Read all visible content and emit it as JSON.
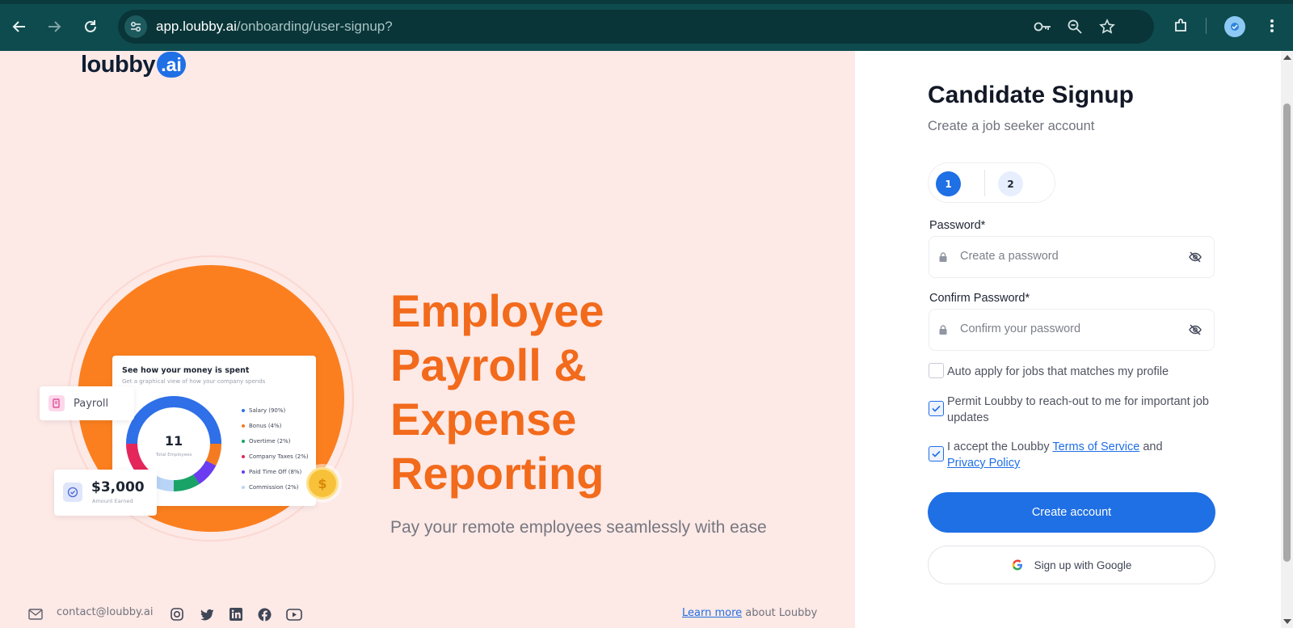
{
  "browser": {
    "url_host": "app.loubby.ai",
    "url_path": "/onboarding/user-signup?"
  },
  "brand": {
    "logo_word": "loubby",
    "logo_suffix": ".ai",
    "accent": "#1f6fe5",
    "orange": "#f26a1b"
  },
  "hero": {
    "headline": [
      "Employee",
      "Payroll &",
      "Expense",
      "Reporting"
    ],
    "tagline": "Pay your remote employees seamlessly with ease",
    "illustration": {
      "card_title": "See how your money is spent",
      "card_subtitle": "Get a graphical view of how your company spends",
      "donut_value": "11",
      "donut_label": "Total Employees",
      "legend": [
        {
          "label": "Salary (90%)",
          "color": "#2f6fe8"
        },
        {
          "label": "Bonus (4%)",
          "color": "#f47b20"
        },
        {
          "label": "Overtime (2%)",
          "color": "#1aa366"
        },
        {
          "label": "Company Taxes (2%)",
          "color": "#e5265a"
        },
        {
          "label": "Paid Time Off (8%)",
          "color": "#6b3cf0"
        },
        {
          "label": "Commission (2%)",
          "color": "#b8d4f6"
        }
      ],
      "payroll_chip": "Payroll",
      "amount_value": "$3,000",
      "amount_label": "Amount Earned"
    }
  },
  "footer": {
    "email": "contact@loubby.ai",
    "learn_more_link": "Learn more",
    "learn_more_suffix": " about Loubby"
  },
  "signup": {
    "title": "Candidate Signup",
    "subtitle": "Create a job seeker account",
    "steps": [
      "1",
      "2"
    ],
    "password_label": "Password*",
    "password_placeholder": "Create a password",
    "confirm_label": "Confirm Password*",
    "confirm_placeholder": "Confirm your password",
    "auto_apply": {
      "label": "Auto apply for jobs that matches my profile",
      "checked": false
    },
    "permit": {
      "label": "Permit Loubby to reach-out to me for important job updates",
      "checked": true
    },
    "terms": {
      "prefix": "I accept the Loubby ",
      "terms_link": "Terms of Service",
      "middle": " and",
      "privacy_link": "Privacy Policy",
      "checked": true
    },
    "create_button": "Create account",
    "google_button": "Sign up with Google"
  }
}
